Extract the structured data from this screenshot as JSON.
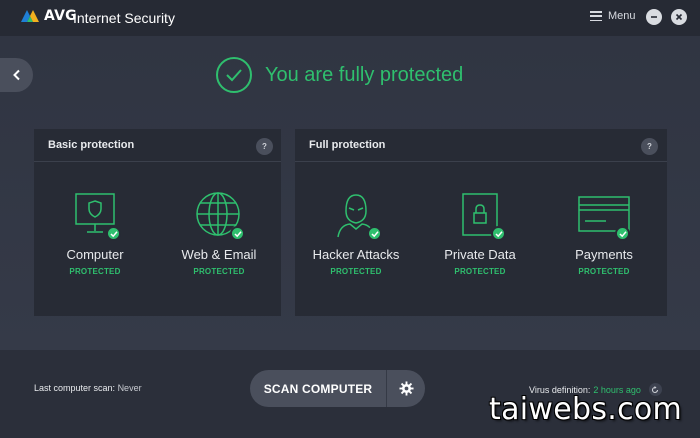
{
  "app": {
    "logo_text": "AVG",
    "title": "Internet Security"
  },
  "window": {
    "menu_label": "Menu"
  },
  "status": {
    "message": "You are fully protected"
  },
  "basic_protection": {
    "title": "Basic protection",
    "help": "?",
    "items": [
      {
        "label": "Computer",
        "state": "PROTECTED",
        "icon": "monitor-shield-icon"
      },
      {
        "label": "Web & Email",
        "state": "PROTECTED",
        "icon": "globe-icon"
      }
    ]
  },
  "full_protection": {
    "title": "Full protection",
    "help": "?",
    "items": [
      {
        "label": "Hacker Attacks",
        "state": "PROTECTED",
        "icon": "hacker-icon"
      },
      {
        "label": "Private Data",
        "state": "PROTECTED",
        "icon": "lock-document-icon"
      },
      {
        "label": "Payments",
        "state": "PROTECTED",
        "icon": "credit-card-icon"
      }
    ]
  },
  "footer": {
    "last_scan_label": "Last computer scan:",
    "last_scan_value": "Never",
    "scan_button": "SCAN COMPUTER",
    "virus_def_label": "Virus definition:",
    "virus_def_value": "2 hours ago"
  },
  "watermark": "taiwebs.com",
  "colors": {
    "accent_green": "#2fbf6e",
    "background": "#2b2f3a",
    "panel": "#272b35"
  }
}
